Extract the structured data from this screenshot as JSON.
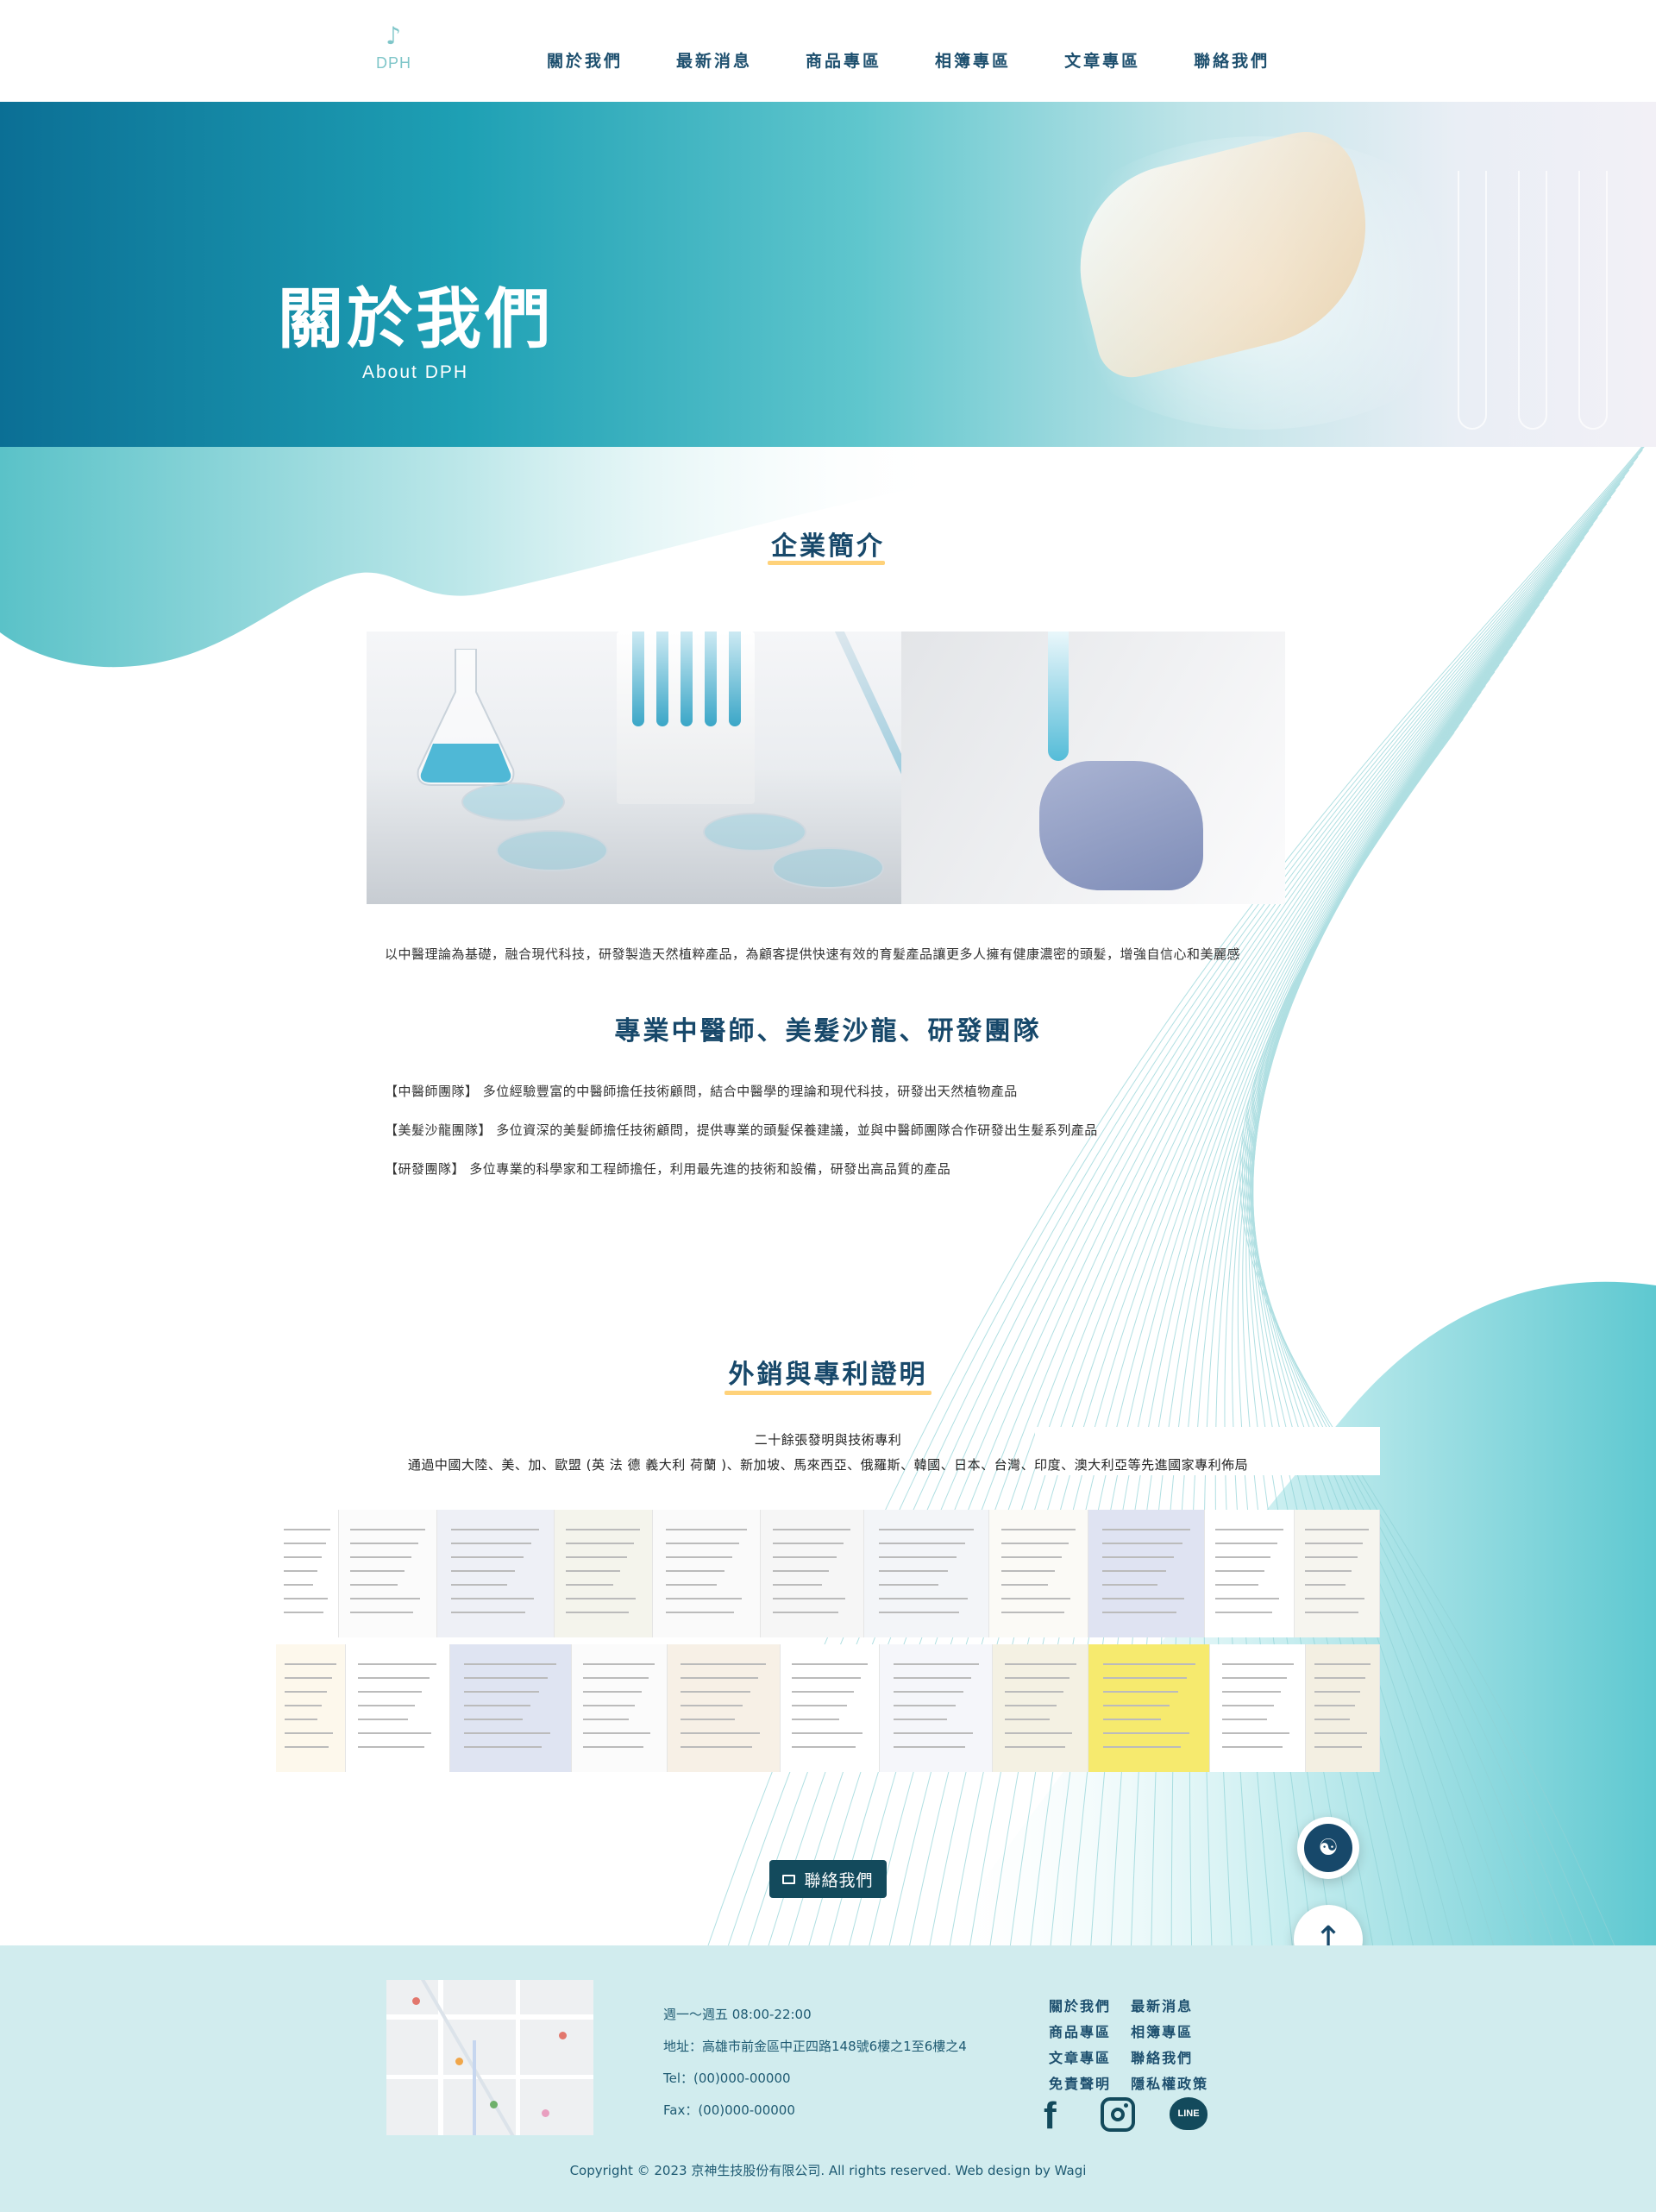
{
  "header": {
    "logo_text": "DPH",
    "nav": [
      "關於我們",
      "最新消息",
      "商品專區",
      "相簿專區",
      "文章專區",
      "聯絡我們"
    ]
  },
  "hero": {
    "title": "關於我們",
    "subtitle": "About DPH"
  },
  "intro": {
    "title": "企業簡介",
    "description": "以中醫理論為基礎，融合現代科技，研發製造天然植粹產品，為顧客提供快速有效的育髮產品讓更多人擁有健康濃密的頭髮，增強自信心和美麗感"
  },
  "team": {
    "title": "專業中醫師、美髮沙龍、研發團隊",
    "items": [
      "【中醫師團隊】 多位經驗豐富的中醫師擔任技術顧問，結合中醫學的理論和現代科技，研發出天然植物產品",
      "【美髮沙龍團隊】 多位資深的美髮師擔任技術顧問，提供專業的頭髮保養建議，並與中醫師團隊合作研發出生髮系列產品",
      "【研發團隊】 多位專業的科學家和工程師擔任，利用最先進的技術和設備，研發出高品質的產品"
    ]
  },
  "patents": {
    "title": "外銷與專利證明",
    "line1": "二十餘張發明與技術專利",
    "line2": "通過中國大陸、美、加、歐盟 (英 法 德 義大利 荷蘭 )、新加坡、馬來西亞、俄羅斯、韓國、日本、台灣、印度、澳大利亞等先進國家專利佈局"
  },
  "contact_button": "聯絡我們",
  "footer": {
    "hours": "週一～週五 08:00-22:00",
    "address": "地址：高雄市前金區中正四路148號6樓之1至6樓之4",
    "tel": "Tel：(00)000-00000",
    "fax": "Fax：(00)000-00000",
    "links": [
      "關於我們",
      "最新消息",
      "商品專區",
      "相簿專區",
      "文章專區",
      "聯絡我們",
      "免責聲明",
      "隱私權政策"
    ],
    "social": [
      "facebook-icon",
      "instagram-icon",
      "line-icon"
    ],
    "line_label": "LINE",
    "copyright": "Copyright © 2023 京神生技股份有限公司. All rights reserved. Web design by Wagi"
  },
  "colors": {
    "primary": "#17486a",
    "accent": "#ffd27a",
    "teal": "#5fc6cd",
    "footer_bg": "#d1ecee"
  }
}
